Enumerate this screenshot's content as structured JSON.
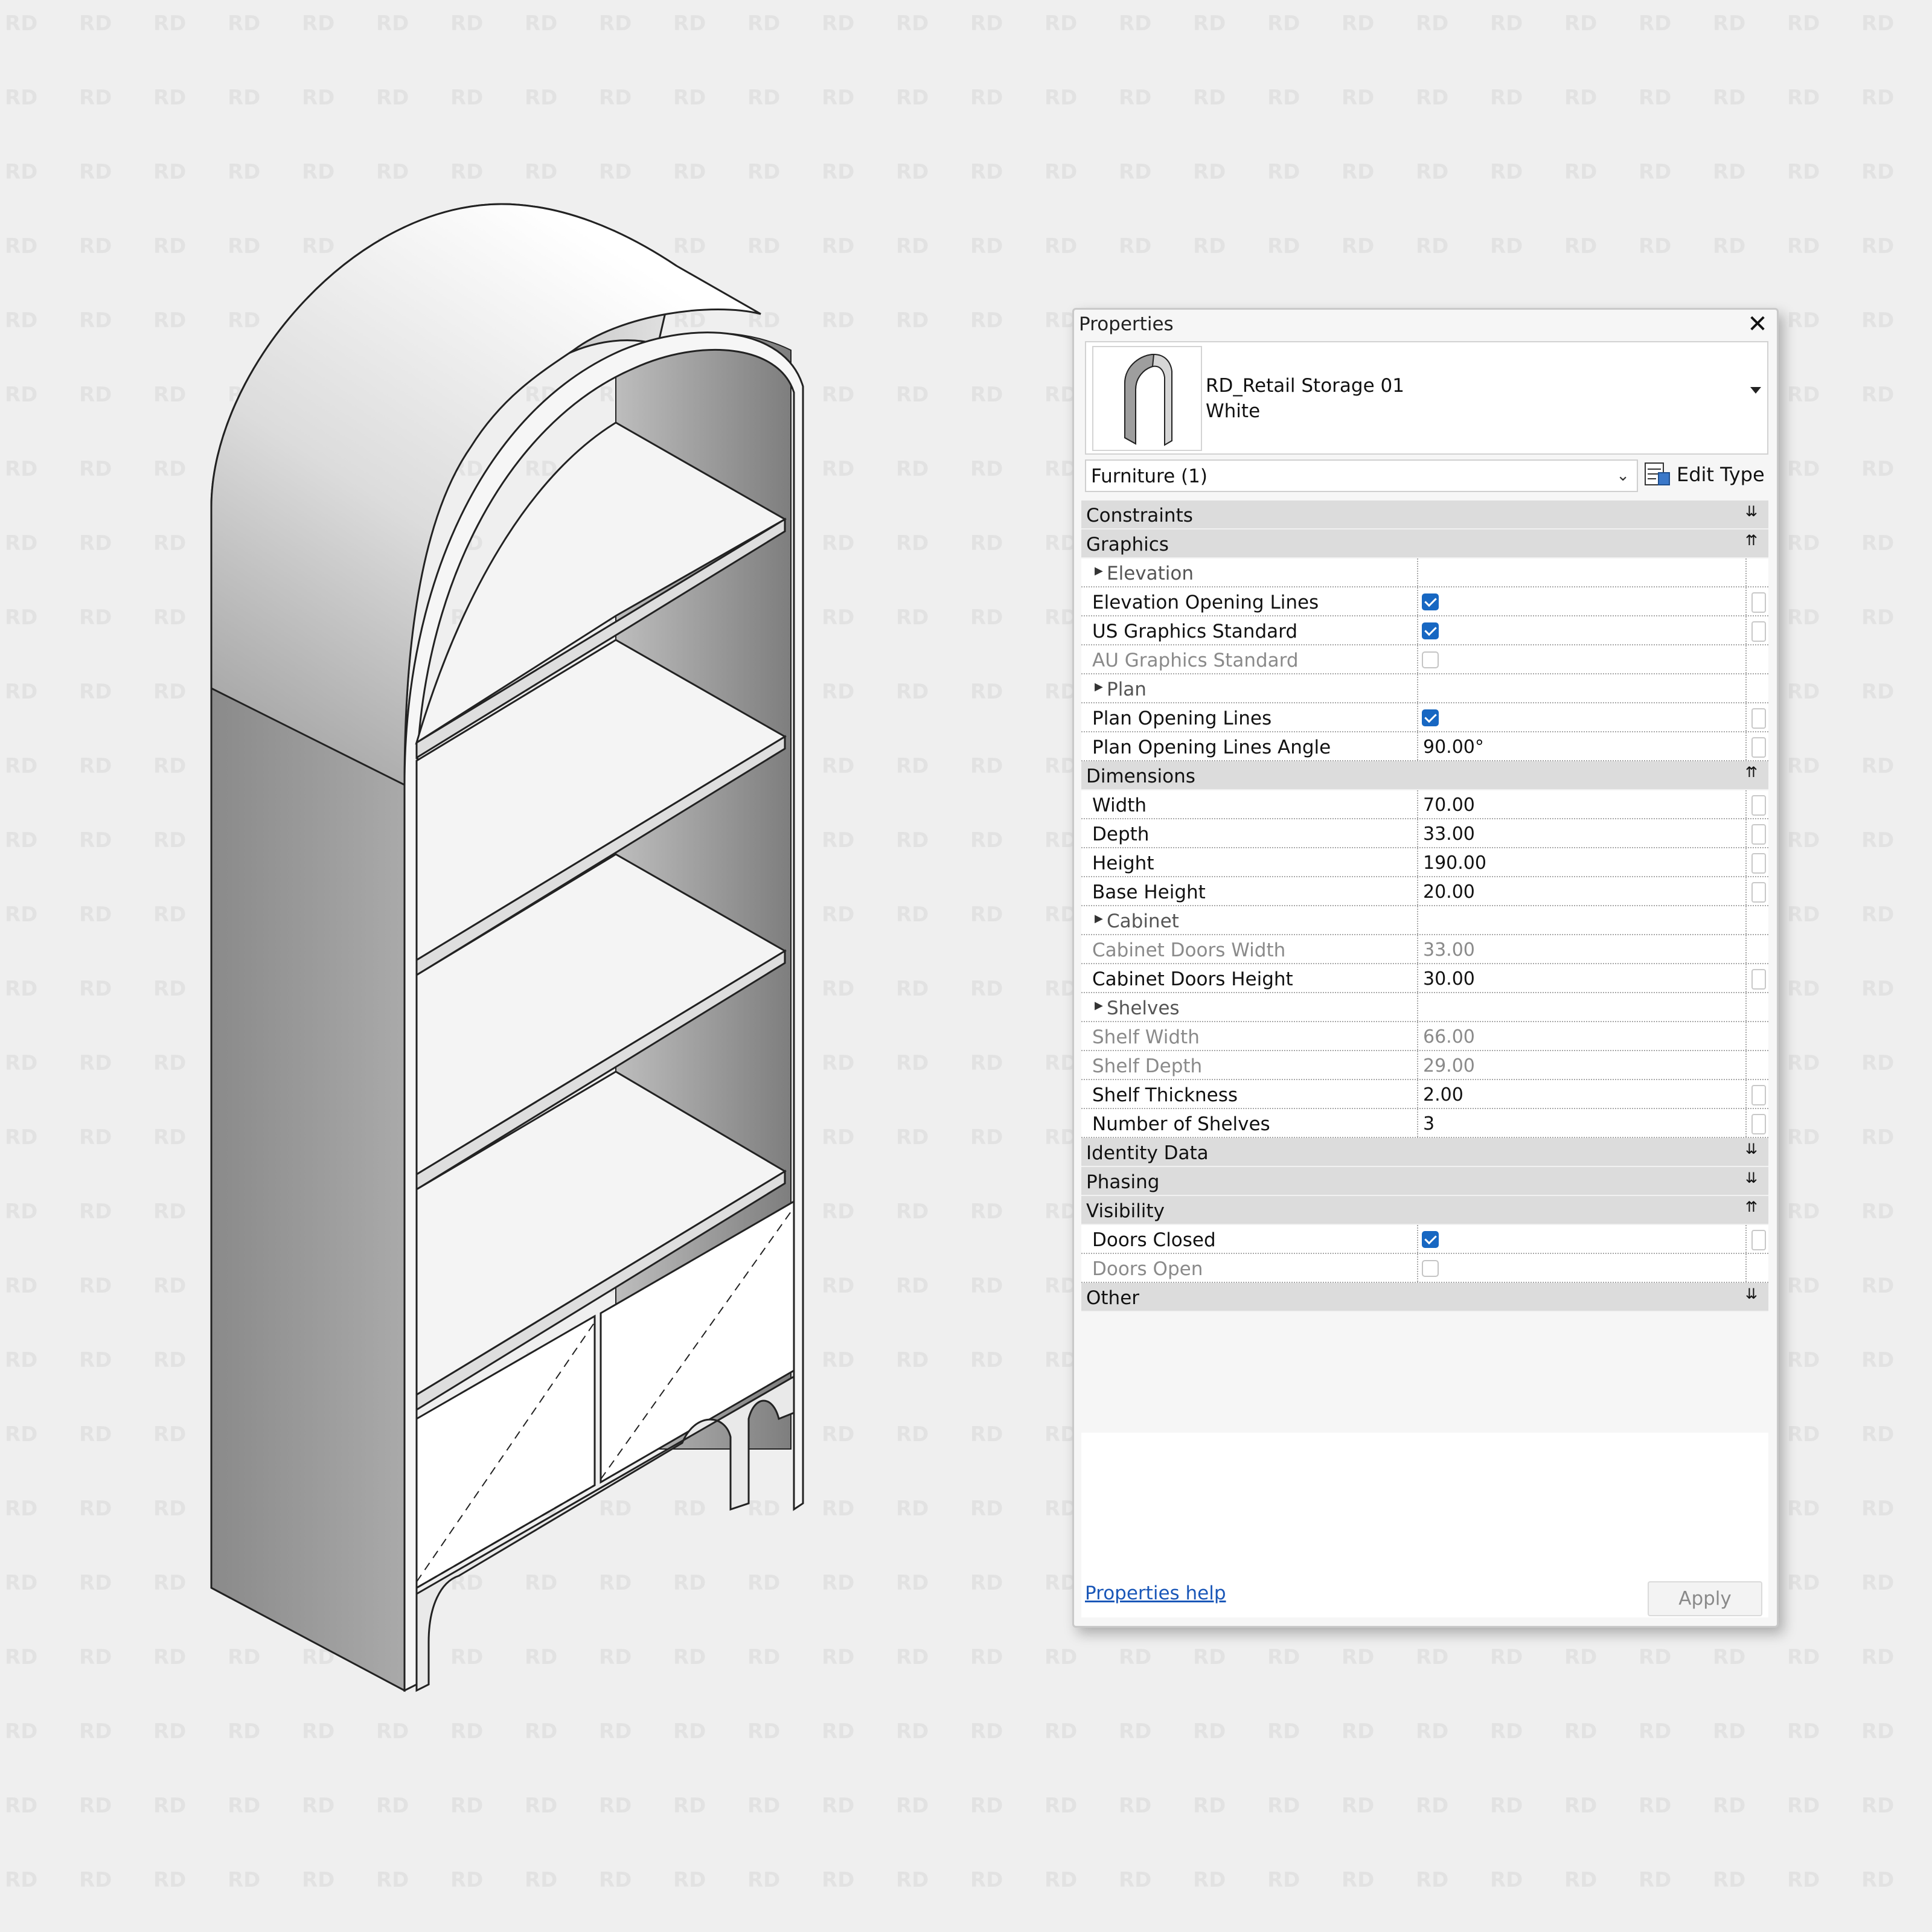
{
  "watermark": {
    "text": "RD"
  },
  "panel": {
    "title": "Properties",
    "close_glyph": "✕",
    "type_selector": {
      "family": "RD_Retail Storage 01",
      "type": "White"
    },
    "instance_filter": "Furniture (1)",
    "edit_type_label": "Edit Type",
    "categories": {
      "constraints": "Constraints",
      "graphics": "Graphics",
      "dimensions": "Dimensions",
      "identity_data": "Identity Data",
      "phasing": "Phasing",
      "visibility": "Visibility",
      "other": "Other"
    },
    "graphics_rows": {
      "elevation_group": "Elevation",
      "elevation_opening_lines": {
        "name": "Elevation Opening Lines",
        "checked": true
      },
      "us_graphics_standard": {
        "name": "US Graphics Standard",
        "checked": true
      },
      "au_graphics_standard": {
        "name": "AU Graphics Standard",
        "checked": false
      },
      "plan_group": "Plan",
      "plan_opening_lines": {
        "name": "Plan Opening Lines",
        "checked": true
      },
      "plan_opening_lines_angle": {
        "name": "Plan Opening Lines Angle",
        "value": "90.00°"
      }
    },
    "dimension_rows": {
      "width": {
        "name": "Width",
        "value": "70.00"
      },
      "depth": {
        "name": "Depth",
        "value": "33.00"
      },
      "height": {
        "name": "Height",
        "value": "190.00"
      },
      "base_height": {
        "name": "Base Height",
        "value": "20.00"
      },
      "cabinet_group": "Cabinet",
      "cabinet_doors_width": {
        "name": "Cabinet Doors Width",
        "value": "33.00"
      },
      "cabinet_doors_height": {
        "name": "Cabinet Doors Height",
        "value": "30.00"
      },
      "shelves_group": "Shelves",
      "shelf_width": {
        "name": "Shelf Width",
        "value": "66.00"
      },
      "shelf_depth": {
        "name": "Shelf Depth",
        "value": "29.00"
      },
      "shelf_thickness": {
        "name": "Shelf Thickness",
        "value": "2.00"
      },
      "number_of_shelves": {
        "name": "Number of Shelves",
        "value": "3"
      }
    },
    "visibility_rows": {
      "doors_closed": {
        "name": "Doors Closed",
        "checked": true
      },
      "doors_open": {
        "name": "Doors Open",
        "checked": false
      }
    },
    "help_link": "Properties help",
    "apply_label": "Apply"
  },
  "colors": {
    "accent": "#1767c2",
    "background": "#efefef",
    "category_band": "#dcdcdc",
    "link": "#1a57b8"
  }
}
